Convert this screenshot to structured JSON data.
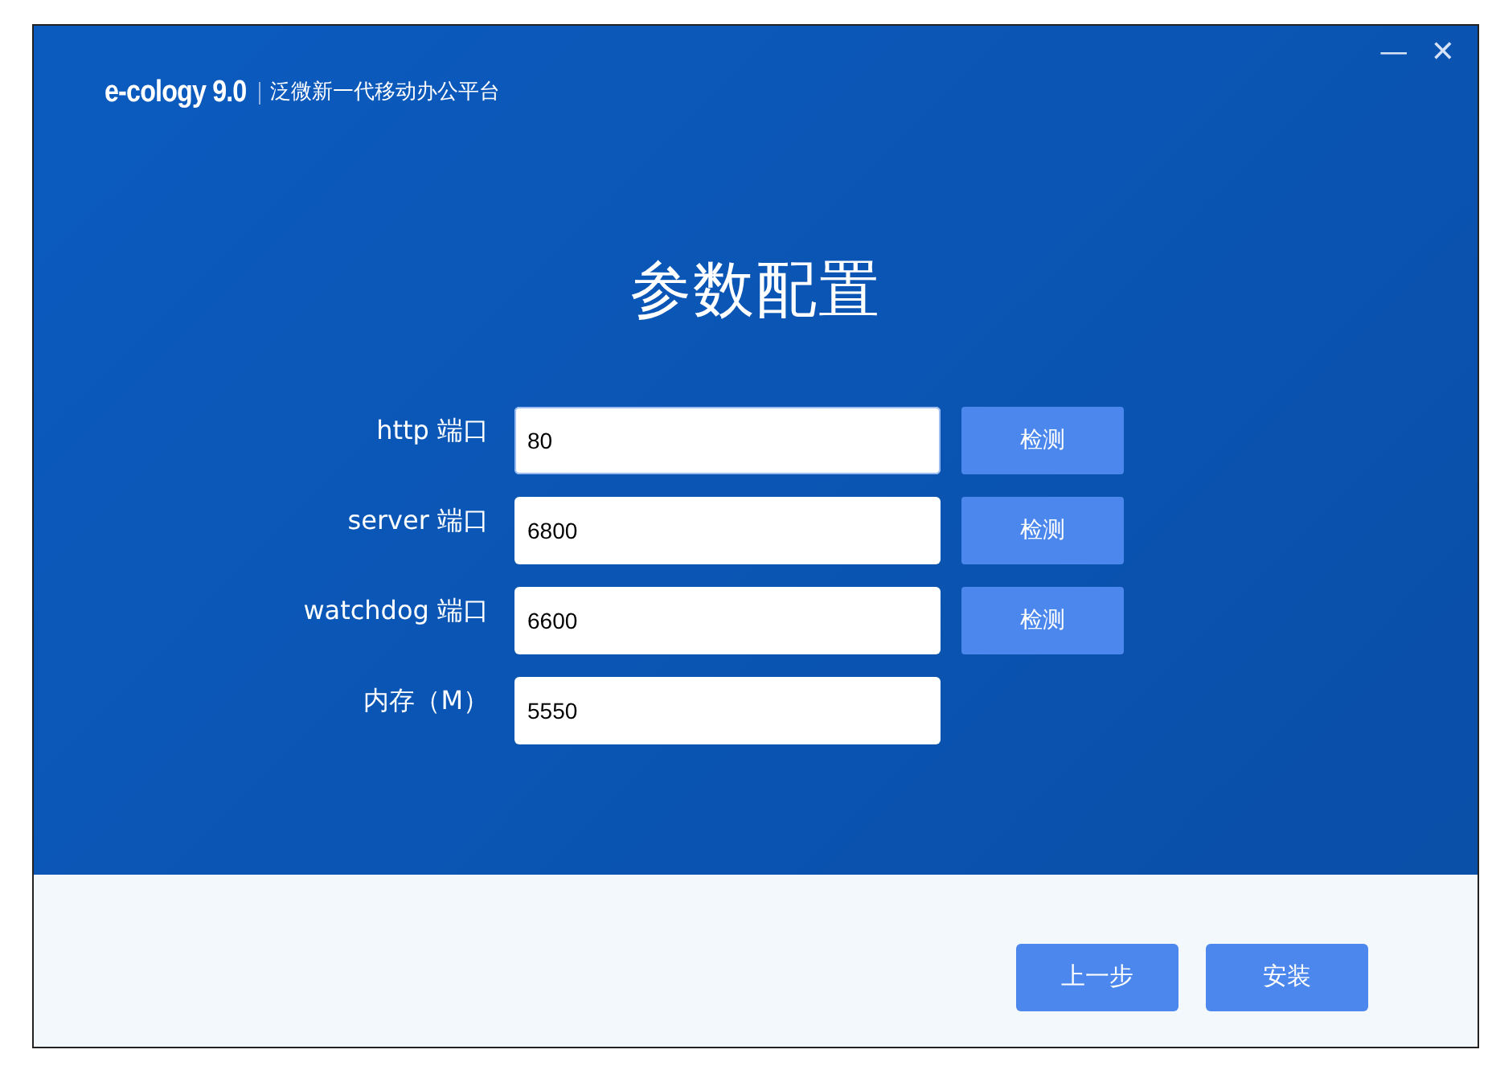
{
  "window": {
    "logo": "e-cology 9.0",
    "subtitle": "泛微新一代移动办公平台",
    "controls": [
      "—",
      "✕"
    ]
  },
  "title": "参数配置",
  "fields": [
    {
      "label": "http 端口",
      "value": "80",
      "focused": true,
      "check_button": "检测"
    },
    {
      "label": "server 端口",
      "value": "6800",
      "focused": false,
      "check_button": "检测"
    },
    {
      "label": "watchdog 端口",
      "value": "6600",
      "focused": false,
      "check_button": "检测"
    },
    {
      "label": "内存（M）",
      "value": "5550",
      "focused": false
    }
  ],
  "buttons": [
    "上一步",
    "安装"
  ]
}
